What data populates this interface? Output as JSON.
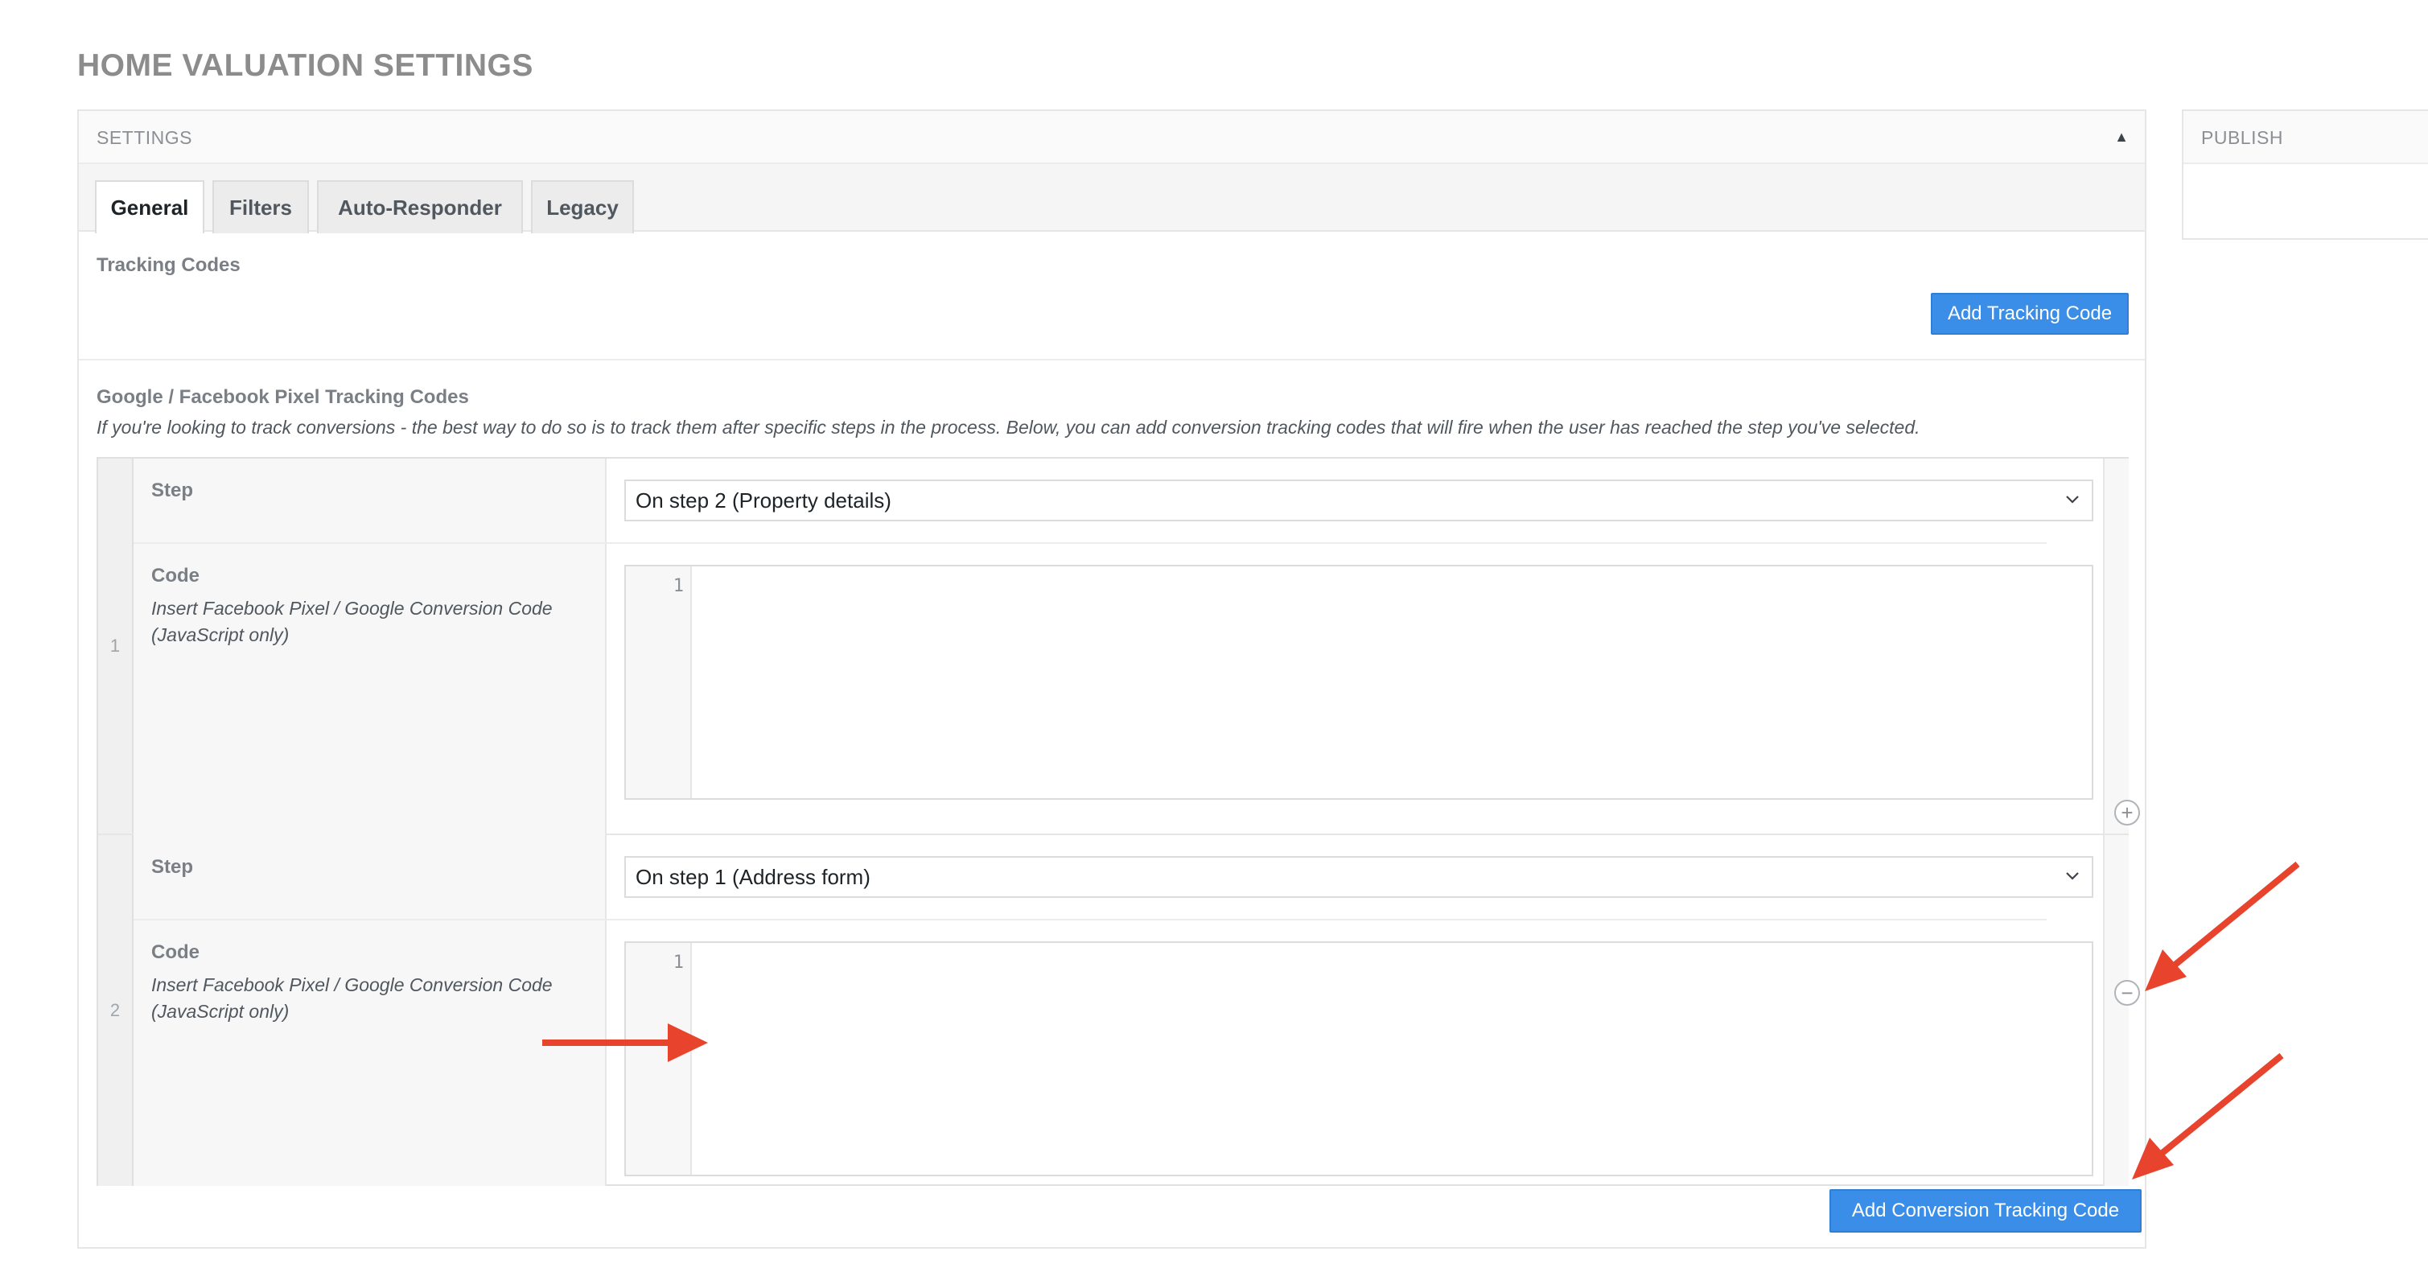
{
  "page": {
    "title": "HOME VALUATION SETTINGS"
  },
  "settings_panel": {
    "header": "SETTINGS",
    "toggle_icon": "triangle-up-icon"
  },
  "tabs": [
    {
      "label": "General",
      "active": true
    },
    {
      "label": "Filters",
      "active": false
    },
    {
      "label": "Auto-Responder",
      "active": false
    },
    {
      "label": "Legacy",
      "active": false
    }
  ],
  "tracking_codes": {
    "title": "Tracking Codes",
    "add_button": "Add Tracking Code"
  },
  "pixel_section": {
    "title": "Google / Facebook Pixel Tracking Codes",
    "description": "If you're looking to track conversions - the best way to do so is to track them after specific steps in the process. Below, you can add conversion tracking codes that will fire when the user has reached the step you've selected."
  },
  "rows": [
    {
      "number": "1",
      "step_label": "Step",
      "step_value": "On step 2 (Property details)",
      "code_label": "Code",
      "code_hint": "Insert Facebook Pixel / Google Conversion Code (JavaScript only)",
      "line_number": "1"
    },
    {
      "number": "2",
      "step_label": "Step",
      "step_value": "On step 1 (Address form)",
      "code_label": "Code",
      "code_hint": "Insert Facebook Pixel / Google Conversion Code (JavaScript only)",
      "line_number": "1"
    }
  ],
  "row_actions": {
    "add_symbol": "+",
    "remove_symbol": "−"
  },
  "add_conversion_button": "Add Conversion Tracking Code",
  "publish_panel": {
    "header": "PUBLISH"
  },
  "colors": {
    "primary_button": "#3b8ee8",
    "annotation_arrow": "#e8432d"
  }
}
